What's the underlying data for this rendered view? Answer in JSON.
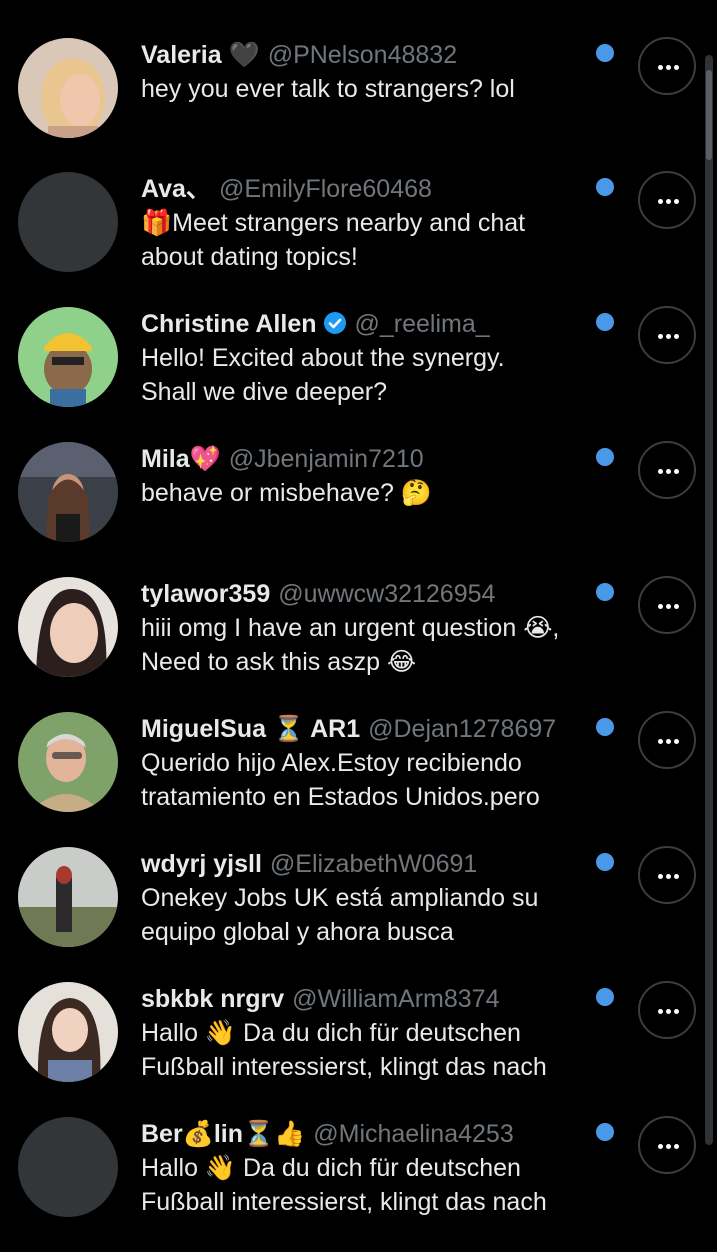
{
  "conversations": [
    {
      "name": "Valeria 🖤",
      "handle": "@PNelson48832",
      "message": "hey you ever talk to strangers? lol",
      "unread": true
    },
    {
      "name": "Ava、",
      "handle": "@EmilyFlore60468",
      "message": "🎁Meet strangers nearby and chat\nabout dating topics!",
      "unread": true
    },
    {
      "name": "Christine Allen",
      "verified": true,
      "handle": "@_reelima_",
      "message": "Hello! Excited about the synergy.\nShall we dive deeper?",
      "unread": true
    },
    {
      "name": "Mila💖",
      "handle": "@Jbenjamin7210",
      "message": "behave or misbehave? 🤔",
      "unread": true
    },
    {
      "name": "tylawor359",
      "handle": "@uwwcw32126954",
      "message": "hiii omg I have an urgent question 😭,\nNeed to ask this aszp 😂",
      "unread": true
    },
    {
      "name": "MiguelSua ⏳ AR1",
      "handle": "@Dejan1278697",
      "message": "Querido hijo Alex.Estoy recibiendo\ntratamiento en Estados Unidos.pero",
      "unread": true
    },
    {
      "name": "wdyrj yjsll",
      "handle": "@ElizabethW0691",
      "message": "Onekey Jobs UK está ampliando su\nequipo global y ahora busca",
      "unread": true
    },
    {
      "name": "sbkbk nrgrv",
      "handle": "@WilliamArm8374",
      "message": "Hallo 👋 Da du dich für deutschen\nFußball interessierst, klingt das nach",
      "unread": true
    },
    {
      "name": "Ber💰lin⏳👍",
      "handle": "@Michaelina4253",
      "message": "Hallo 👋 Da du dich für deutschen\nFußball interessierst, klingt das nach",
      "unread": true
    }
  ],
  "colors": {
    "background": "#000000",
    "text_primary": "#e7e9ea",
    "text_secondary": "#71767b",
    "unread_dot": "#4a99e9",
    "verified_badge": "#1d9bf0",
    "more_button_border": "#3a3d41"
  },
  "icons": {
    "more": "more-horizontal-icon",
    "verified": "verified-badge-icon",
    "unread": "unread-dot-icon"
  }
}
